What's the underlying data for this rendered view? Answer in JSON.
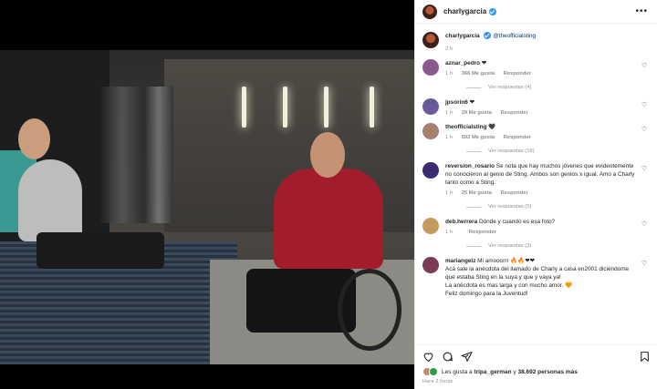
{
  "post": {
    "author": "charlygarcia",
    "verified": true,
    "more_icon": "more-horizontal-icon",
    "caption": {
      "author": "charlygarcia",
      "mention": "@theofficialsting",
      "time": "2 h"
    }
  },
  "comments": [
    {
      "user": "aznar_pedro",
      "text": "❤",
      "time": "1 h",
      "likes": "366 Me gusta",
      "reply": "Responder",
      "view_replies": "Ver respuestas (4)",
      "avatar_color": "#8b5a8c"
    },
    {
      "user": "jpsorin6",
      "text": "❤",
      "time": "1 h",
      "likes": "29 Me gusta",
      "reply": "Responder",
      "view_replies": "",
      "avatar_color": "#6b5a9a"
    },
    {
      "user": "theofficialsting",
      "text": "🖤",
      "time": "1 h",
      "likes": "592 Me gusta",
      "reply": "Responder",
      "view_replies": "Ver respuestas (19)",
      "avatar_color": "#a67e6a"
    },
    {
      "user": "reversion_rosario",
      "text": "Se nota que hay muchos jóvenes que evidentemente no conocieron al genio de Sting. Ambos son genios x igual. Amo a Charly tanto como a Sting.",
      "time": "1 h",
      "likes": "25 Me gusta",
      "reply": "Responder",
      "view_replies": "Ver respuestas (5)",
      "avatar_color": "#3c2a6e"
    },
    {
      "user": "deb.herrera",
      "text": "Dónde y cuando es esa foto?",
      "time": "1 h",
      "likes": "",
      "reply": "Responder",
      "view_replies": "Ver respuestas (3)",
      "avatar_color": "#c29a5e"
    },
    {
      "user": "mariangelz",
      "text": "Mi amooorrr 🔥🔥❤❤\nAcá sale la anécdota del llamado de Charly a casa en2001 diciéndome que estaba Sting en la suya y que y vaya ya!\nLa anécdota es mas larga y con mucho amor. 🧡\nFeliz domingo para la Juventud!",
      "time": "",
      "likes": "",
      "reply": "",
      "view_replies": "",
      "avatar_color": "#7a3b55"
    }
  ],
  "actions": {
    "like_icon": "heart-outline-icon",
    "comment_icon": "comment-icon",
    "share_icon": "paper-plane-icon",
    "save_icon": "bookmark-icon"
  },
  "likes_summary": {
    "prefix": "Les gusta a",
    "first_user": "tripa_german",
    "middle": "y",
    "count": "38.692 personas más"
  },
  "posted_ago": "Hace 2 horas",
  "colors": {
    "verified_blue": "#3897f0",
    "muted_text": "#8e8e8e",
    "link": "#00376b"
  }
}
